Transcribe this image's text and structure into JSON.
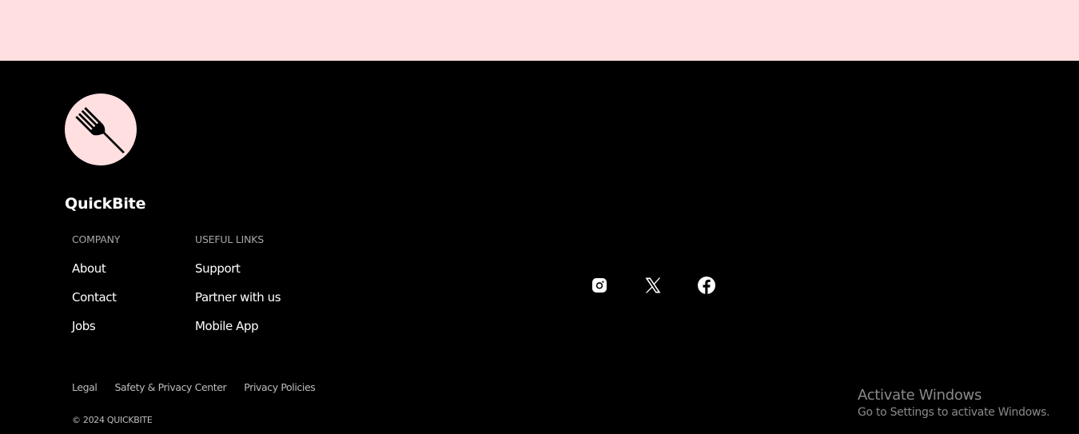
{
  "brand": {
    "name": "QuickBite",
    "logo_icon": "fork-icon",
    "logo_bg_color": "#ffdfe0"
  },
  "footer": {
    "background_color": "#000000",
    "company": {
      "heading": "COMPANY",
      "links": [
        {
          "label": "About"
        },
        {
          "label": "Contact"
        },
        {
          "label": "Jobs"
        }
      ]
    },
    "useful_links": {
      "heading": "USEFUL LINKS",
      "links": [
        {
          "label": "Support"
        },
        {
          "label": "Partner with us"
        },
        {
          "label": "Mobile App"
        }
      ]
    },
    "socials": [
      {
        "icon": "instagram-icon"
      },
      {
        "icon": "x-icon"
      },
      {
        "icon": "facebook-icon"
      }
    ],
    "legal_links": [
      {
        "label": "Legal"
      },
      {
        "label": "Safety & Privacy Center"
      },
      {
        "label": "Privacy Policies"
      }
    ],
    "copyright": "© 2024 QUICKBITE"
  },
  "top_band": {
    "color": "#ffdfe0"
  },
  "windows_watermark": {
    "title": "Activate Windows",
    "subtitle": "Go to Settings to activate Windows."
  }
}
